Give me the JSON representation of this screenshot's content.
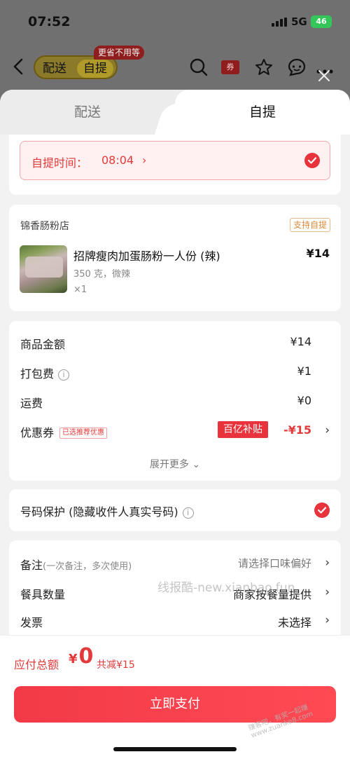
{
  "status": {
    "time": "07:52",
    "network": "5G",
    "battery": "46"
  },
  "nav": {
    "toggle_delivery": "配送",
    "toggle_pickup": "自提",
    "save_tag": "更省不用等",
    "coupon_icon_label": "券",
    "icons": [
      "back-icon",
      "search-icon",
      "coupon-icon",
      "star-icon",
      "chat-icon",
      "more-icon",
      "close-icon"
    ]
  },
  "tabs": {
    "delivery": "配送",
    "pickup": "自提",
    "active": "pickup"
  },
  "pickup_time": {
    "label": "自提时间：",
    "value": "08:04",
    "chevron": "›"
  },
  "shop": {
    "name": "锦香肠粉店",
    "tag": "支持自提",
    "item": {
      "name": "招牌瘦肉加蛋肠粉一人份 (辣)",
      "spec": "350 克，微辣",
      "qty": "×1",
      "price": "¥14"
    }
  },
  "fees": {
    "goods_label": "商品金额",
    "goods_value": "¥14",
    "packing_label": "打包费",
    "packing_value": "¥1",
    "shipping_label": "运费",
    "shipping_value": "¥0",
    "coupon_label": "优惠券",
    "coupon_tag": "已选推荐优惠",
    "subsidy": "百亿补贴",
    "coupon_value": "-¥15",
    "expand": "展开更多 ⌄"
  },
  "privacy": {
    "label": "号码保护 (隐藏收件人真实号码)"
  },
  "misc": {
    "note_label": "备注",
    "note_hint": "(一次备注，多次使用)",
    "note_value": "请选择口味偏好",
    "tableware_label": "餐具数量",
    "tableware_value": "商家按餐量提供",
    "invoice_label": "发票",
    "invoice_value": "未选择"
  },
  "watermark": "线报酷-new.xianbao.fun",
  "corner_mark": "赚客吧，有奖一起赚 www.zuanke8.com",
  "bottom": {
    "total_label": "应付总额",
    "currency": "¥",
    "total_value": "0",
    "saved": "共减¥15",
    "pay_button": "立即支付"
  },
  "colors": {
    "accent": "#e8333c",
    "pickup_bg": "#fff1f1"
  }
}
